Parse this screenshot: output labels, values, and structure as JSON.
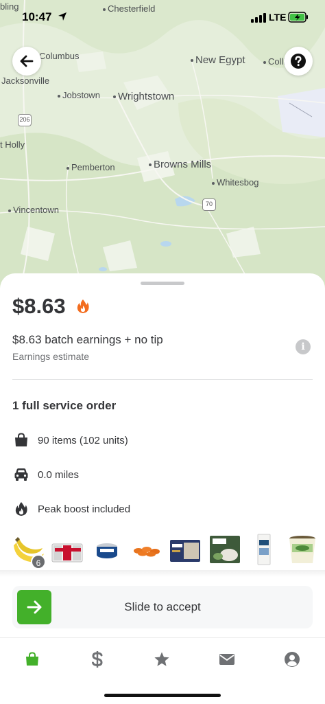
{
  "status_bar": {
    "time": "10:47",
    "network": "LTE"
  },
  "map": {
    "towns": [
      {
        "id": "chesterfield",
        "name": "Chesterfield"
      },
      {
        "id": "bling",
        "name": "bling"
      },
      {
        "id": "columbus",
        "name": "Columbus"
      },
      {
        "id": "new-egypt",
        "name": "New Egypt"
      },
      {
        "id": "colli",
        "name": "Colli"
      },
      {
        "id": "jacksonville",
        "name": "Jacksonville"
      },
      {
        "id": "jobstown",
        "name": "Jobstown"
      },
      {
        "id": "wrightstown",
        "name": "Wrightstown"
      },
      {
        "id": "t-holly",
        "name": "t Holly"
      },
      {
        "id": "pemberton",
        "name": "Pemberton"
      },
      {
        "id": "browns-mills",
        "name": "Browns Mills"
      },
      {
        "id": "whitesbog",
        "name": "Whitesbog"
      },
      {
        "id": "vincentown",
        "name": "Vincentown"
      }
    ],
    "routes": {
      "r206": "206",
      "r70": "70"
    }
  },
  "offer": {
    "price": "$8.63",
    "earnings_line": "$8.63 batch earnings + no tip",
    "earnings_estimate": "Earnings estimate",
    "order_title": "1 full service order",
    "details": {
      "items": "90 items (102 units)",
      "distance": "0.0 miles",
      "boost": "Peak boost included"
    },
    "first_product_count": "6",
    "products": [
      "bananas",
      "coke-pack",
      "tuna-cans",
      "baby-carrots",
      "frozen-pasta",
      "riced-cauliflower",
      "creamer",
      "ice-cream-pint"
    ],
    "slide_label": "Slide to accept"
  },
  "colors": {
    "accent_green": "#43b02a",
    "flame_orange": "#f36d1f",
    "text": "#343538"
  },
  "icons": {
    "back": "arrow-left-icon",
    "help": "question-icon",
    "info": "info-icon",
    "bag": "bag-icon",
    "car": "car-icon",
    "flame": "flame-icon",
    "tabs": [
      "bag-icon",
      "dollar-icon",
      "star-icon",
      "mail-icon",
      "profile-icon"
    ]
  }
}
